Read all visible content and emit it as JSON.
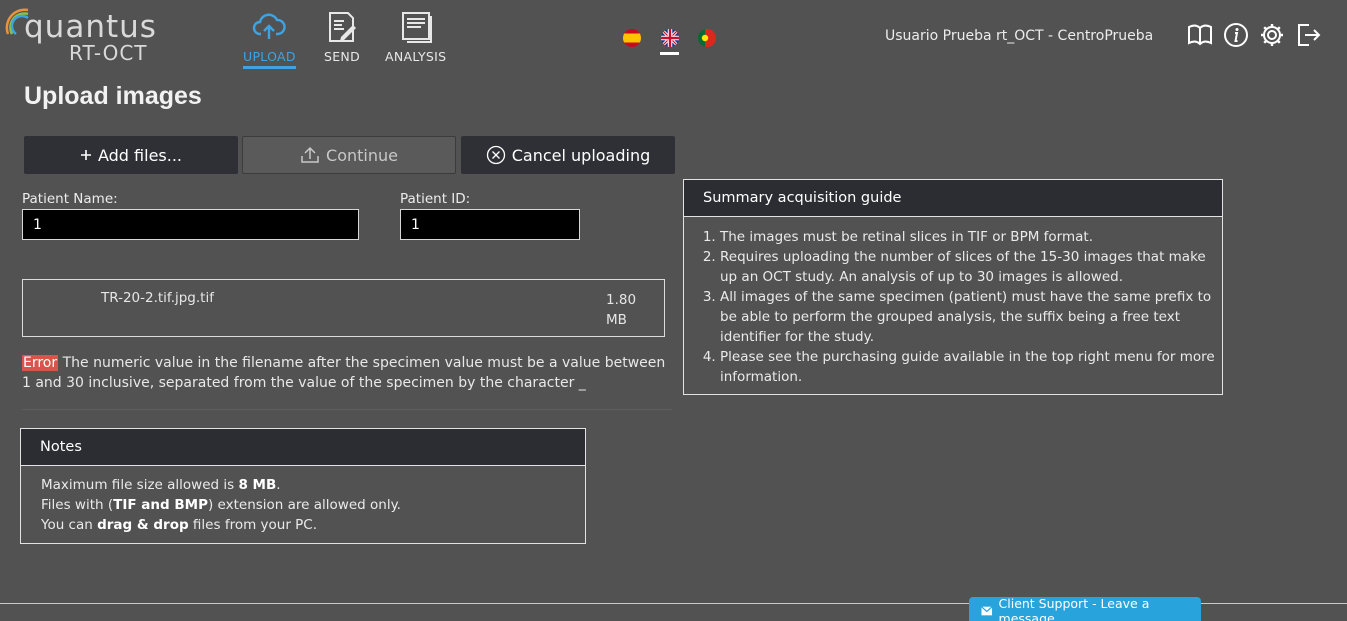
{
  "header": {
    "logo_word": "quantus",
    "logo_sub": "RT-OCT",
    "nav": [
      {
        "label": "UPLOAD",
        "icon": "cloud-upload-icon",
        "active": true
      },
      {
        "label": "SEND",
        "icon": "send-document-icon",
        "active": false
      },
      {
        "label": "ANALYSIS",
        "icon": "analysis-document-icon",
        "active": false
      }
    ],
    "languages": [
      "es",
      "en",
      "pt"
    ],
    "selected_language": "en",
    "user": "Usuario Prueba rt_OCT - CentroPrueba",
    "icons": [
      "book-icon",
      "info-icon",
      "gear-icon",
      "logout-icon"
    ]
  },
  "page": {
    "title": "Upload images"
  },
  "toolbar": {
    "add_label": "Add files...",
    "continue_label": "Continue",
    "cancel_label": "Cancel uploading"
  },
  "form": {
    "patient_name_label": "Patient Name:",
    "patient_name_value": "1",
    "patient_id_label": "Patient ID:",
    "patient_id_value": "1"
  },
  "files": [
    {
      "name": "TR-20-2.tif.jpg.tif",
      "size_value": "1.80",
      "size_unit": "MB"
    }
  ],
  "error": {
    "badge": "Error",
    "message": "The numeric value in the filename after the specimen value must be a value between 1 and 30 inclusive, separated from the value of the specimen by the character _"
  },
  "guide": {
    "title": "Summary acquisition guide",
    "items": [
      "The images must be retinal slices in TIF or BPM format.",
      "Requires uploading the number of slices of the 15-30 images that make up an OCT study. An analysis of up to 30 images is allowed.",
      "All images of the same specimen (patient) must have the same prefix to be able to perform the grouped analysis, the suffix being a free text identifier for the study.",
      "Please see the purchasing guide available in the top right menu for more information."
    ]
  },
  "notes": {
    "title": "Notes",
    "line1_pre": "Maximum file size allowed is ",
    "line1_bold": "8 MB",
    "line1_post": ".",
    "line2_pre": "Files with (",
    "line2_bold": "TIF and BMP",
    "line2_post": ") extension are allowed only.",
    "line3_pre": "You can ",
    "line3_bold": "drag & drop",
    "line3_post": " files from your PC."
  },
  "support": {
    "label": "Client Support - Leave a message"
  },
  "colors": {
    "background": "#535252",
    "accent": "#3ea3e0",
    "dark_button": "#2f3035",
    "error_badge": "#d9534f",
    "support": "#29a3dc"
  }
}
